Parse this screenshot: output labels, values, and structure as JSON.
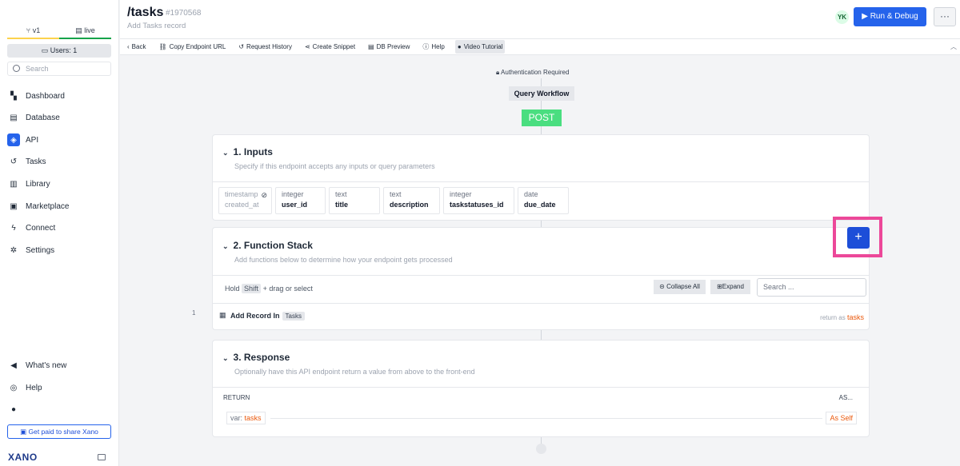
{
  "sidebar": {
    "branch_v1": "v1",
    "branch_live": "live",
    "users": "Users: 1",
    "search_placeholder": "Search",
    "nav": [
      {
        "label": "Dashboard",
        "icon": "dashboard-icon"
      },
      {
        "label": "Database",
        "icon": "database-icon"
      },
      {
        "label": "API",
        "icon": "api-icon"
      },
      {
        "label": "Tasks",
        "icon": "tasks-icon"
      },
      {
        "label": "Library",
        "icon": "library-icon"
      },
      {
        "label": "Marketplace",
        "icon": "marketplace-icon"
      },
      {
        "label": "Connect",
        "icon": "connect-icon"
      },
      {
        "label": "Settings",
        "icon": "settings-icon"
      }
    ],
    "bottom": [
      {
        "label": "What's new",
        "icon": "megaphone-icon"
      },
      {
        "label": "Help",
        "icon": "help-icon"
      }
    ],
    "share": "Get paid to share Xano",
    "logo": "XANO"
  },
  "header": {
    "title": "/tasks",
    "id": "#1970568",
    "subtitle": "Add Tasks record",
    "avatar": "YK",
    "run": "Run & Debug",
    "more": "···"
  },
  "toolbar": {
    "back": "Back",
    "copy": "Copy Endpoint URL",
    "history": "Request History",
    "snippet": "Create Snippet",
    "db": "DB Preview",
    "help": "Help",
    "video": "Video Tutorial"
  },
  "canvas": {
    "auth": "Authentication Required",
    "workflow": "Query Workflow",
    "method": "POST"
  },
  "inputs": {
    "title": "1. Inputs",
    "desc": "Specify if this endpoint accepts any inputs or query parameters",
    "items": [
      {
        "type": "timestamp",
        "name": "created_at"
      },
      {
        "type": "integer",
        "name": "user_id"
      },
      {
        "type": "text",
        "name": "title"
      },
      {
        "type": "text",
        "name": "description"
      },
      {
        "type": "integer",
        "name": "taskstatuses_id"
      },
      {
        "type": "date",
        "name": "due_date"
      }
    ]
  },
  "stack": {
    "title": "2. Function Stack",
    "desc": "Add functions below to determine how your endpoint gets processed",
    "hold": "Hold",
    "shift": "Shift",
    "hold_rest": "+ drag or select",
    "collapse": "Collapse All",
    "expand": "Expand",
    "search_placeholder": "Search ...",
    "row_num": "1",
    "record": "Add Record In",
    "table": "Tasks",
    "return_as": "return as",
    "return_var": "tasks",
    "add": "+"
  },
  "response": {
    "title": "3. Response",
    "desc": "Optionally have this API endpoint return a value from above to the front-end",
    "return": "RETURN",
    "as": "AS...",
    "var_prefix": "var:",
    "var": "tasks",
    "as_self": "As Self"
  }
}
